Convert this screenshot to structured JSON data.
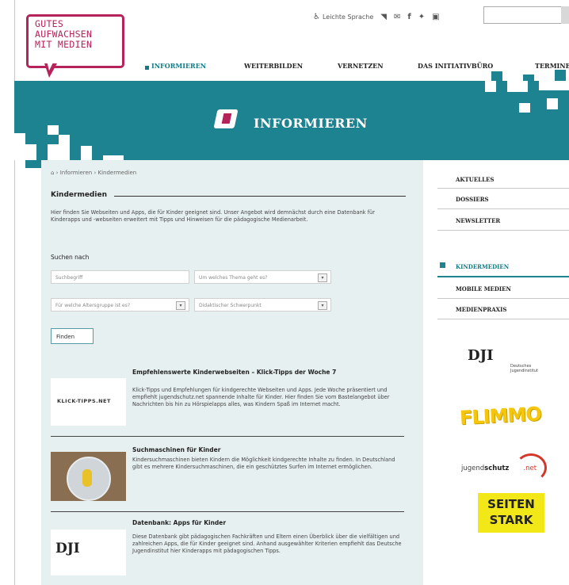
{
  "logo": {
    "line1": "GUTES",
    "line2": "AUFWACHSEN",
    "line3": "MIT MEDIEN"
  },
  "topbar": {
    "leichte_sprache": "Leichte Sprache",
    "icons": [
      "rss-icon",
      "mail-icon",
      "facebook-icon",
      "twitter-icon",
      "youtube-icon"
    ]
  },
  "search": {
    "placeholder": ""
  },
  "nav": [
    "INFORMIEREN",
    "WEITERBILDEN",
    "VERNETZEN",
    "DAS INITIATIVBÜRO",
    "TERMINE"
  ],
  "banner": {
    "title": "INFORMIEREN"
  },
  "breadcrumb": "⌂ › Informieren › Kindermedien",
  "page_title": "Kindermedien",
  "intro": "Hier finden Sie Webseiten und Apps, die für Kinder geeignet sind. Unser Angebot wird demnächst durch eine Datenbank für Kinderapps und -webseiten erweitert mit Tipps und Hinweisen für die pädagogische Medienarbeit.",
  "search_form": {
    "label": "Suchen nach",
    "keyword_placeholder": "Suchbegriff",
    "topic_placeholder": "Um welches Thema geht es?",
    "age_placeholder": "Für welche Altersgruppe ist es?",
    "focus_placeholder": "Didaktischer Schwerpunkt",
    "find_button": "Finden"
  },
  "items": [
    {
      "title": "Empfehlenswerte Kinderwebseiten – Klick-Tipps der Woche 7",
      "text": "Klick-Tipps und Empfehlungen für kindgerechte Webseiten und Apps. Jede Woche präsentiert und empfiehlt jugendschutz.net spannende Inhalte für Kinder. Hier finden Sie vom Bastelangebot über Nachrichten bis hin zu Hörspielapps alles, was Kindern Spaß im Internet macht.",
      "thumb_label": "KLICK-TIPPS.NET"
    },
    {
      "title": "Suchmaschinen für Kinder",
      "text": "Kindersuchmaschinen bieten Kindern die Möglichkeit kindgerechte Inhalte zu finden. In Deutschland gibt es mehrere Kindersuchmaschinen, die ein geschütztes Surfen im Internet ermöglichen.",
      "thumb_label": ""
    },
    {
      "title": "Datenbank: Apps für Kinder",
      "text": "Diese Datenbank gibt pädagogischen Fachkräften und Eltern einen Überblick über die vielfältigen und zahlreichen Apps, die für Kinder geeignet sind. Anhand ausgewählter Kriterien empfiehlt das Deutsche Jugendinstitut hier Kinderapps mit pädagogischen Tipps.",
      "thumb_label": "DJI"
    }
  ],
  "sidebar": {
    "group1": [
      "AKTUELLES",
      "DOSSIERS",
      "NEWSLETTER"
    ],
    "group2": [
      "KINDERMEDIEN",
      "MOBILE MEDIEN",
      "MEDIENPRAXIS"
    ]
  },
  "partners": {
    "dji": "DJI",
    "dji_sub": "Deutsches Jugendinstitut",
    "flimmo": "FLIMMO",
    "jugendschutz_a": "jugend",
    "jugendschutz_b": "schutz",
    "jugendschutz_c": ".net",
    "seiten1": "SEITEN",
    "seiten2": "STARK"
  },
  "colors": {
    "teal": "#1d8390",
    "magenta": "#b5235a",
    "content_bg": "#e7f0f1"
  }
}
